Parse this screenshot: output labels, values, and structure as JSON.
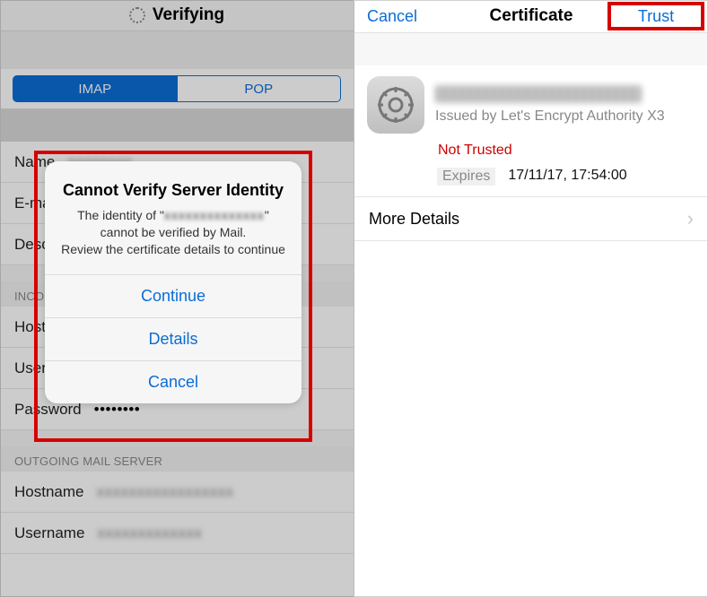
{
  "left": {
    "header_title": "Verifying",
    "tabs": {
      "imap": "IMAP",
      "pop": "POP"
    },
    "fields": {
      "name_label": "Name",
      "email_label": "E-mail",
      "desc_label": "Description",
      "host_label": "Hostname",
      "user_label": "Username",
      "pass_label": "Password",
      "pass_value": "••••••••",
      "out_host_label": "Hostname",
      "out_user_label": "Username"
    },
    "sections": {
      "incoming": "INCOMING MAIL SERVER",
      "outgoing": "OUTGOING MAIL SERVER"
    }
  },
  "alert": {
    "title": "Cannot Verify Server Identity",
    "body_prefix": "The identity of \"",
    "body_suffix": "\" cannot be verified by Mail.",
    "body_line2": "Review the certificate details to continue",
    "continue": "Continue",
    "details": "Details",
    "cancel": "Cancel"
  },
  "right": {
    "cancel": "Cancel",
    "title": "Certificate",
    "trust": "Trust",
    "issued_prefix": "Issued by ",
    "issued_by": "Let's Encrypt Authority X3",
    "not_trusted": "Not Trusted",
    "expires_label": "Expires",
    "expires_value": "17/11/17, 17:54:00",
    "more_details": "More Details"
  }
}
